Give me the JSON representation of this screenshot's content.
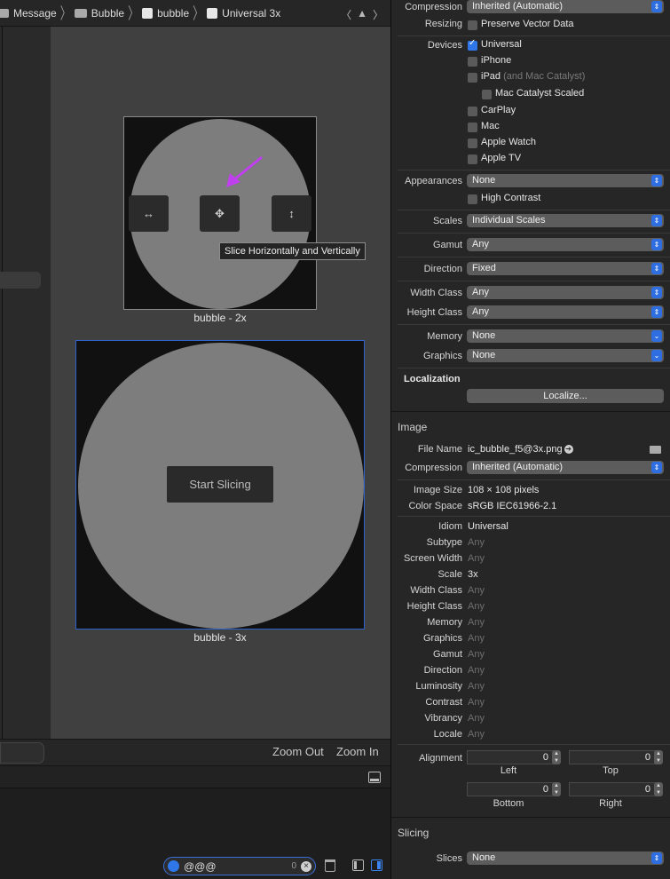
{
  "breadcrumb": {
    "items": [
      "Message",
      "Bubble",
      "bubble",
      "Universal 3x"
    ]
  },
  "canvas": {
    "tooltip": "Slice Horizontally and Vertically",
    "caption_2x": "bubble - 2x",
    "caption_3x": "bubble - 3x",
    "start_slicing": "Start Slicing",
    "slice_icons": [
      "↔",
      "✥",
      "↕"
    ],
    "zoom_out": "Zoom Out",
    "zoom_in": "Zoom In"
  },
  "console": {
    "filter_value": "@@@",
    "filter_count": "0"
  },
  "inspector": {
    "compression_label": "Compression",
    "compression_value": "Inherited (Automatic)",
    "resizing_label": "Resizing",
    "preserve_vector": "Preserve Vector Data",
    "devices_label": "Devices",
    "devices": {
      "universal": "Universal",
      "iphone": "iPhone",
      "ipad": "iPad",
      "ipad_note": "(and Mac Catalyst)",
      "mac_catalyst_scaled": "Mac Catalyst Scaled",
      "carplay": "CarPlay",
      "mac": "Mac",
      "apple_watch": "Apple Watch",
      "apple_tv": "Apple TV"
    },
    "appearances_label": "Appearances",
    "appearances_value": "None",
    "high_contrast": "High Contrast",
    "scales_label": "Scales",
    "scales_value": "Individual Scales",
    "gamut_label": "Gamut",
    "gamut_value": "Any",
    "direction_label": "Direction",
    "direction_value": "Fixed",
    "width_class_label": "Width Class",
    "width_class_value": "Any",
    "height_class_label": "Height Class",
    "height_class_value": "Any",
    "memory_label": "Memory",
    "memory_value": "None",
    "graphics_label": "Graphics",
    "graphics_value": "None",
    "localization_title": "Localization",
    "localize_button": "Localize...",
    "image_title": "Image",
    "file_name_label": "File Name",
    "file_name_value": "ic_bubble_f5@3x.png",
    "compression2_label": "Compression",
    "compression2_value": "Inherited (Automatic)",
    "image_size_label": "Image Size",
    "image_size_value": "108 × 108 pixels",
    "color_space_label": "Color Space",
    "color_space_value": "sRGB IEC61966-2.1",
    "props": [
      {
        "label": "Idiom",
        "value": "Universal",
        "dim": false
      },
      {
        "label": "Subtype",
        "value": "Any",
        "dim": true
      },
      {
        "label": "Screen Width",
        "value": "Any",
        "dim": true
      },
      {
        "label": "Scale",
        "value": "3x",
        "dim": false
      },
      {
        "label": "Width Class",
        "value": "Any",
        "dim": true
      },
      {
        "label": "Height Class",
        "value": "Any",
        "dim": true
      },
      {
        "label": "Memory",
        "value": "Any",
        "dim": true
      },
      {
        "label": "Graphics",
        "value": "Any",
        "dim": true
      },
      {
        "label": "Gamut",
        "value": "Any",
        "dim": true
      },
      {
        "label": "Direction",
        "value": "Any",
        "dim": true
      },
      {
        "label": "Luminosity",
        "value": "Any",
        "dim": true
      },
      {
        "label": "Contrast",
        "value": "Any",
        "dim": true
      },
      {
        "label": "Vibrancy",
        "value": "Any",
        "dim": true
      },
      {
        "label": "Locale",
        "value": "Any",
        "dim": true
      }
    ],
    "alignment_label": "Alignment",
    "alignment": {
      "left": "0",
      "left_label": "Left",
      "top": "0",
      "top_label": "Top",
      "bottom": "0",
      "bottom_label": "Bottom",
      "right": "0",
      "right_label": "Right"
    },
    "slicing_title": "Slicing",
    "slices_label": "Slices",
    "slices_value": "None"
  },
  "colors": {
    "accent": "#2f77e8",
    "arrow": "#c040f0",
    "selection": "#2f63c9"
  }
}
